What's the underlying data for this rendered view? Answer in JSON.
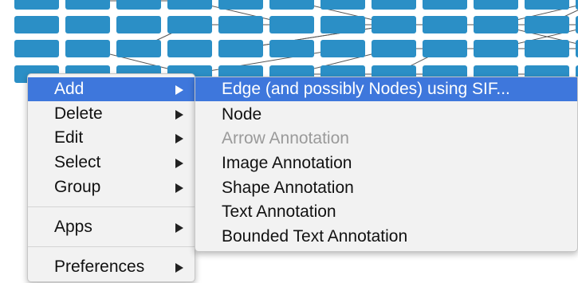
{
  "colors": {
    "node_fill": "#2b8fc6",
    "edge": "#555555",
    "menu_bg": "#f2f2f2",
    "highlight": "#3e77dc",
    "disabled_text": "#9a9a9a"
  },
  "context_menu": {
    "items": [
      {
        "label": "Add",
        "has_submenu": true,
        "highlighted": true
      },
      {
        "label": "Delete",
        "has_submenu": true
      },
      {
        "label": "Edit",
        "has_submenu": true
      },
      {
        "label": "Select",
        "has_submenu": true
      },
      {
        "label": "Group",
        "has_submenu": true
      },
      {
        "label": "Apps",
        "has_submenu": true
      },
      {
        "label": "Preferences",
        "has_submenu": true
      }
    ]
  },
  "add_submenu": {
    "items": [
      {
        "label": "Edge (and possibly Nodes) using SIF...",
        "highlighted": true
      },
      {
        "label": "Node"
      },
      {
        "label": "Arrow Annotation",
        "disabled": true
      },
      {
        "label": "Image Annotation"
      },
      {
        "label": "Shape Annotation"
      },
      {
        "label": "Text Annotation"
      },
      {
        "label": "Bounded Text Annotation"
      }
    ]
  }
}
